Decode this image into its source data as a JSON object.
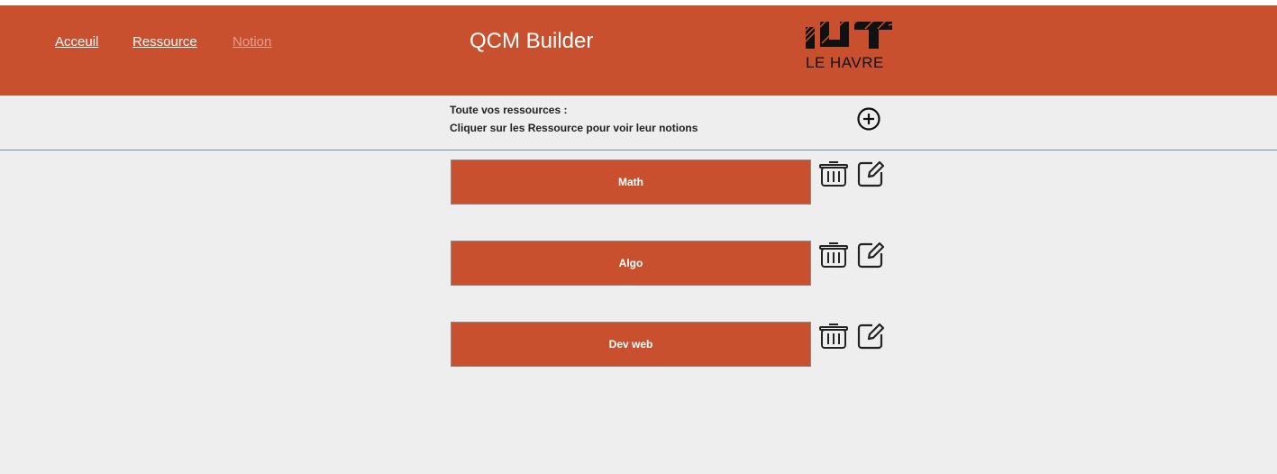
{
  "nav": {
    "items": [
      {
        "label": "Acceuil",
        "muted": false
      },
      {
        "label": "Ressource",
        "muted": false
      },
      {
        "label": "Notion",
        "muted": true
      }
    ]
  },
  "header": {
    "title": "QCM Builder",
    "logo_text": "LE HAVRE",
    "logo_mark": "IUT"
  },
  "intro": {
    "line1": "Toute vos ressources :",
    "line2": "Cliquer sur les Ressource pour voir leur notions"
  },
  "icons": {
    "add": "plus-circle-icon",
    "delete": "trash-icon",
    "edit": "edit-icon"
  },
  "colors": {
    "brand": "#c8502e",
    "background": "#eeeeee",
    "text_light": "#ffffff"
  },
  "resources": [
    {
      "label": "Math"
    },
    {
      "label": "Algo"
    },
    {
      "label": "Dev web"
    }
  ]
}
